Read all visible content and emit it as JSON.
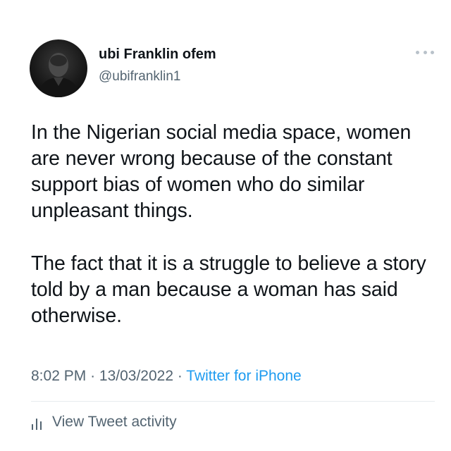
{
  "user": {
    "display_name": "ubi Franklin ofem",
    "handle": "@ubifranklin1"
  },
  "tweet": {
    "paragraphs": [
      "In the Nigerian social media space, women are never wrong because of the constant support bias of women who do similar unpleasant things.",
      "The fact that it is a struggle to believe a story told by a man because a woman has said otherwise."
    ],
    "time": "8:02 PM",
    "date": "13/03/2022",
    "separator": "·",
    "source": "Twitter for iPhone"
  },
  "actions": {
    "view_activity_label": "View Tweet activity"
  },
  "icons": {
    "more": "more-dots-icon",
    "activity": "bar-chart-icon"
  },
  "colors": {
    "text": "#0f1419",
    "secondary": "#536471",
    "link": "#1d9bf0"
  }
}
